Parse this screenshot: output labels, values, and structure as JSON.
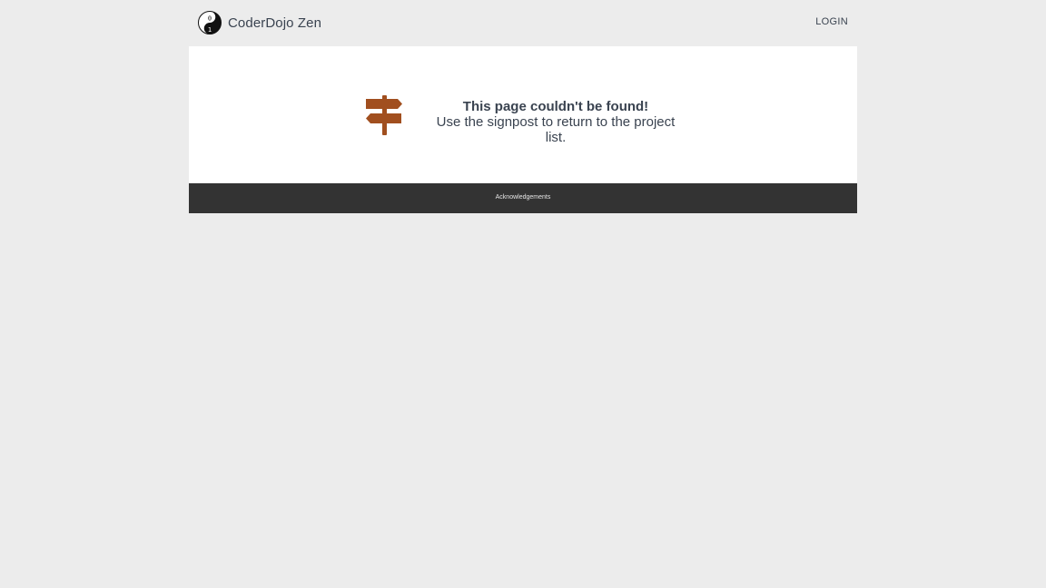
{
  "header": {
    "brand_name": "CoderDojo Zen",
    "logo_icon": "coderdojo-yin-yang-icon",
    "login_label": "LOGIN"
  },
  "main": {
    "icon": "signpost-icon",
    "icon_color": "#a14f1f",
    "title": "This page couldn't be found!",
    "subtitle": "Use the signpost to return to the project list."
  },
  "footer": {
    "acknowledgements_label": "Acknowledgements",
    "background": "#333333"
  },
  "colors": {
    "page_background": "#ececec",
    "text": "#3a4350"
  }
}
